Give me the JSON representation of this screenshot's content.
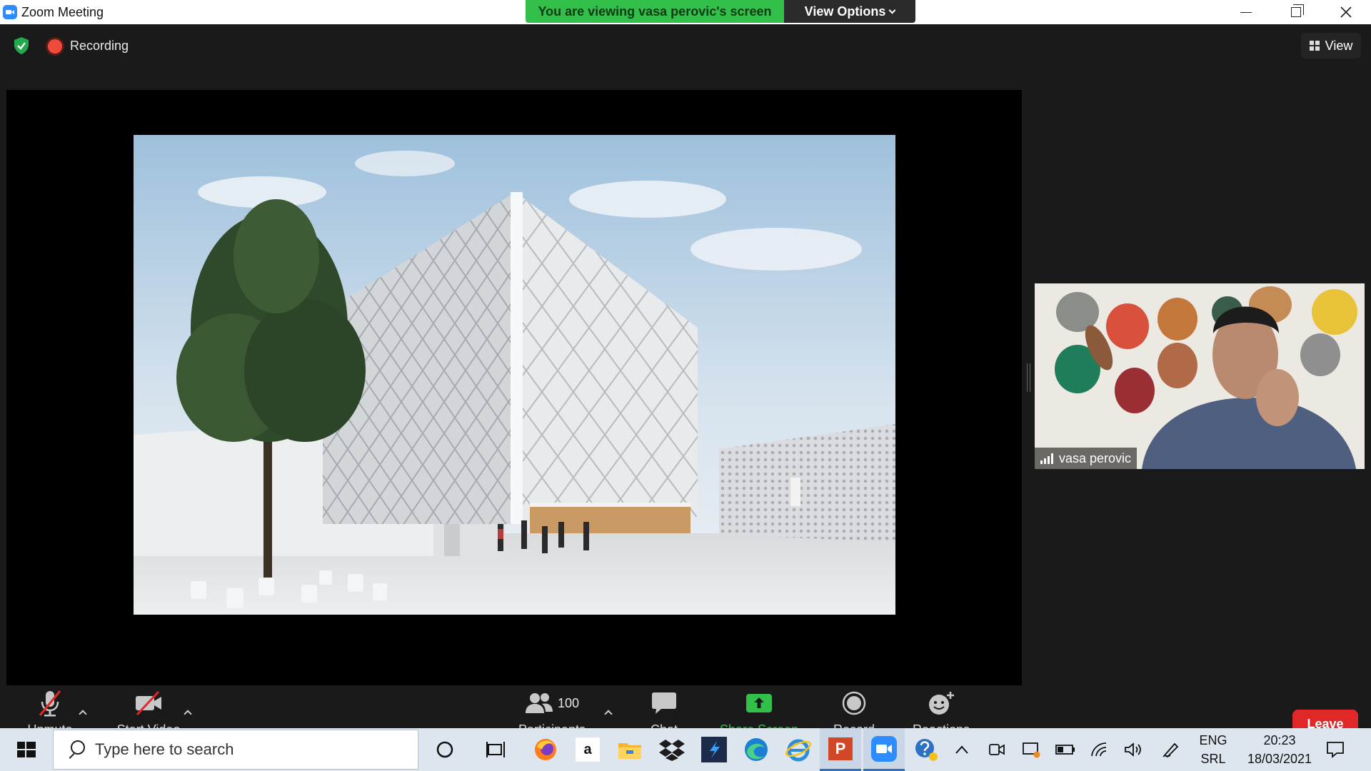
{
  "window": {
    "title": "Zoom Meeting",
    "banner": "You are viewing vasa perovic's screen",
    "view_options": "View Options"
  },
  "meeting": {
    "recording_label": "Recording",
    "view_label": "View"
  },
  "participant": {
    "name": "vasa perovic"
  },
  "controls": {
    "unmute": "Unmute",
    "start_video": "Start Video",
    "participants_count": "100",
    "participants": "Participants",
    "chat": "Chat",
    "share_screen": "Share Screen",
    "record": "Record",
    "reactions": "Reactions",
    "leave": "Leave"
  },
  "taskbar": {
    "search_placeholder": "Type here to search",
    "lang_top": "ENG",
    "lang_bottom": "SRL",
    "time": "20:23",
    "date": "18/03/2021",
    "apps": [
      "cortana-icon",
      "task-view-icon",
      "firefox-icon",
      "amazon-icon",
      "file-explorer-icon",
      "dropbox-icon",
      "app-icon",
      "edge-icon",
      "internet-explorer-icon",
      "powerpoint-icon",
      "zoom-icon"
    ],
    "amazon_glyph": "a",
    "ppt_glyph": "P"
  },
  "colors": {
    "accent_green": "#33c04a",
    "leave_red": "#e02828",
    "zoom_blue": "#2d8cff"
  }
}
